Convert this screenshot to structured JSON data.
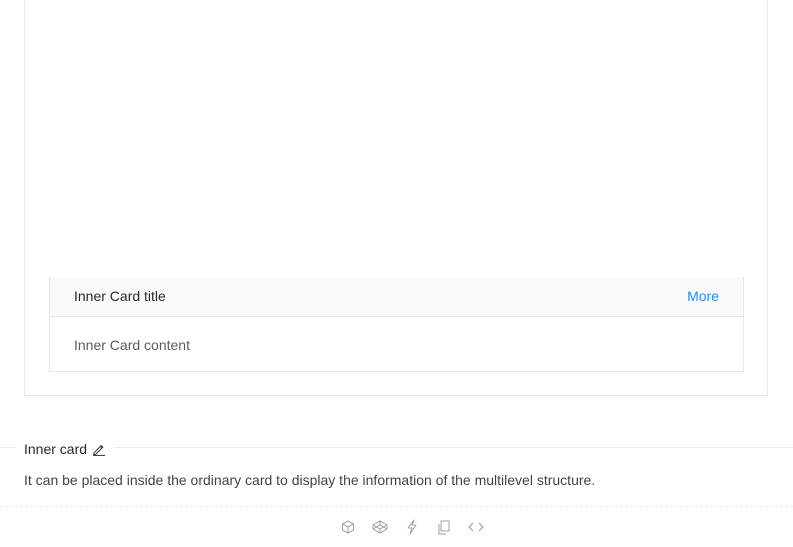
{
  "example": {
    "inner_card": {
      "title": "Inner Card title",
      "extra_link": "More",
      "content": "Inner Card content"
    },
    "meta": {
      "title": "Inner card",
      "description": "It can be placed inside the ordinary card to display the information of the multilevel structure."
    },
    "actions": [
      {
        "icon": "codesandbox-icon"
      },
      {
        "icon": "codepen-icon"
      },
      {
        "icon": "riddle-icon"
      },
      {
        "icon": "copy-icon"
      },
      {
        "icon": "expand-code-icon"
      }
    ],
    "colors": {
      "link": "#1890ff",
      "border": "#e8e8e8",
      "head_background": "#fafafa"
    }
  }
}
